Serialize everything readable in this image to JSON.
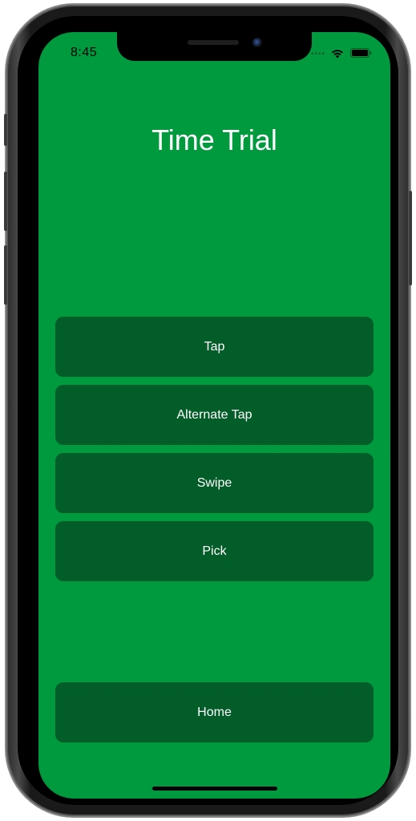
{
  "status_bar": {
    "time": "8:45",
    "signal_dots": "••••",
    "wifi_icon": "wifi-icon",
    "battery_icon": "battery-icon"
  },
  "screen": {
    "title": "Time Trial",
    "background_color": "#009a3e",
    "button_color": "#025d28"
  },
  "menu": {
    "buttons": [
      {
        "label": "Tap"
      },
      {
        "label": "Alternate Tap"
      },
      {
        "label": "Swipe"
      },
      {
        "label": "Pick"
      }
    ],
    "home_label": "Home"
  }
}
